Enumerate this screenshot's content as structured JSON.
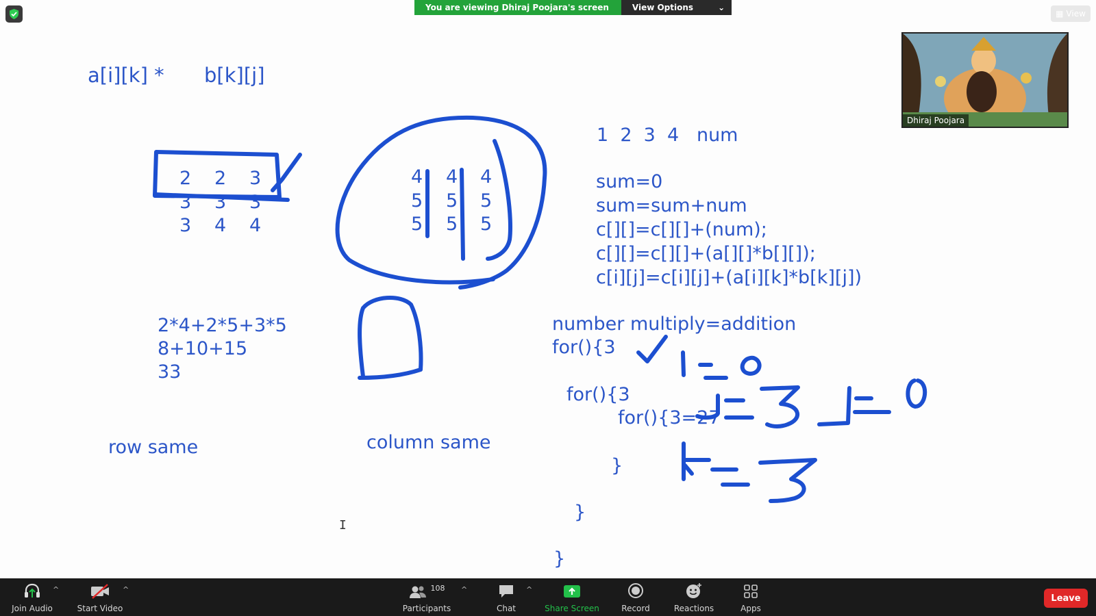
{
  "banner": {
    "viewing": "You are viewing Dhiraj Poojara's screen",
    "view_options": "View Options"
  },
  "view_button": {
    "label": "View"
  },
  "participant_tile": {
    "name": "Dhiraj Poojara"
  },
  "whiteboard": {
    "header_left": "a[i][k] *",
    "header_right": "b[k][j]",
    "matrix_a": [
      [
        "2",
        "2",
        "3"
      ],
      [
        "3",
        "3",
        "3"
      ],
      [
        "3",
        "4",
        "4"
      ]
    ],
    "matrix_b": [
      [
        "4",
        "4",
        "4"
      ],
      [
        "5",
        "5",
        "5"
      ],
      [
        "5",
        "5",
        "5"
      ]
    ],
    "calc": [
      "2*4+2*5+3*5",
      "8+10+15",
      "33"
    ],
    "row_same": "row same",
    "column_same": "column same",
    "nums": "1  2  3  4   num",
    "code_lines": [
      "sum=0",
      "sum=sum+num",
      "c[][]=c[][]+(num);",
      "c[][]=c[][]+(a[][]*b[][]);",
      "c[i][j]=c[i][j]+(a[i][k]*b[k][j])"
    ],
    "loop_lines": [
      "number multiply=addition",
      "for(){3",
      "for(){3",
      "for(){3=27",
      "}",
      "}",
      "}"
    ]
  },
  "toolbar": {
    "join_audio": "Join Audio",
    "start_video": "Start Video",
    "participants": "Participants",
    "participant_count": "108",
    "chat": "Chat",
    "share_screen": "Share Screen",
    "record": "Record",
    "reactions": "Reactions",
    "apps": "Apps",
    "leave": "Leave"
  },
  "colors": {
    "ink": "#2c56c8",
    "share_green": "#23a33a",
    "leave_red": "#e02828",
    "toolbar_bg": "#1a1a1a"
  },
  "icons": [
    "shield-icon",
    "grid-icon",
    "headphones-icon",
    "video-off-icon",
    "participants-icon",
    "chat-icon",
    "share-screen-icon",
    "record-icon",
    "reactions-icon",
    "apps-icon",
    "caret-up-icon",
    "chevron-down-icon"
  ]
}
